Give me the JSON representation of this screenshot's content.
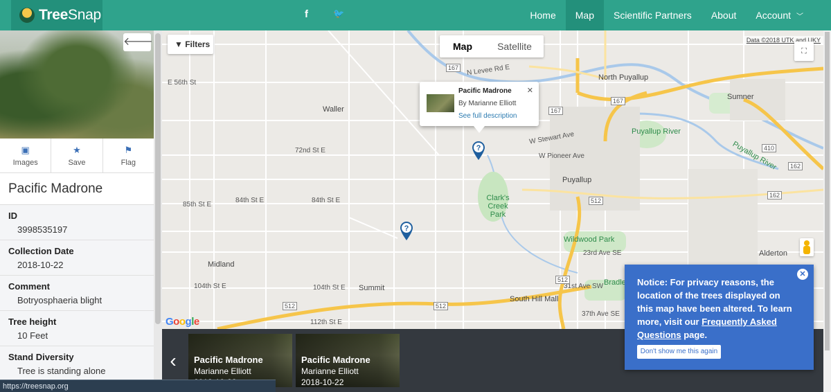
{
  "brand": {
    "name_bold": "Tree",
    "name_rest": "Snap"
  },
  "nav": {
    "social": {
      "facebook": "f",
      "twitter": "🐦"
    },
    "links": [
      "Home",
      "Map",
      "Scientific Partners",
      "About",
      "Account"
    ],
    "active": "Map"
  },
  "sidebar": {
    "back_icon": "arrow-left-icon",
    "actions": [
      {
        "label": "Images",
        "icon": "image-icon"
      },
      {
        "label": "Save",
        "icon": "star-icon"
      },
      {
        "label": "Flag",
        "icon": "flag-icon"
      }
    ],
    "title": "Pacific Madrone",
    "fields": [
      {
        "label": "ID",
        "value": "3998535197"
      },
      {
        "label": "Collection Date",
        "value": "2018-10-22"
      },
      {
        "label": "Comment",
        "value": "Botryosphaeria blight"
      },
      {
        "label": "Tree height",
        "value": "10 Feet"
      },
      {
        "label": "Stand Diversity",
        "value": "Tree is standing alone"
      }
    ]
  },
  "map": {
    "filters_label": "Filters",
    "type_options": [
      "Map",
      "Satellite"
    ],
    "selected_type": "Map",
    "attribution": "Data ©2018 UTK and UKY",
    "google": "Google",
    "labels": {
      "waller": "Waller",
      "north_puyallup": "North Puyallup",
      "sumner": "Sumner",
      "puyallup": "Puyallup",
      "puyallup_river_1": "Puyallup River",
      "puyallup_river_2": "Puyallup River",
      "clarks_creek_park": "Clark's Creek Park",
      "wildwood_park": "Wildwood Park",
      "midland": "Midland",
      "summit": "Summit",
      "alderton": "Alderton",
      "south_hill_mall": "South Hill Mall",
      "bradley": "Bradley",
      "st_72": "72nd St E",
      "st_84": "84th St E",
      "st_84b": "84th St E",
      "st_85": "85th St E",
      "st_104": "104th St E",
      "st_104b": "104th St E",
      "st_112": "112th St E",
      "st_31st": "31st Ave SW",
      "st_23rd": "23rd Ave SE",
      "st_37th": "37th Ave SE",
      "w_pioneer": "W Pioneer Ave",
      "w_stewart": "W Stewart Ave",
      "n_levee": "N Levee Rd E",
      "e_56th": "E 56th St",
      "shields": [
        "167",
        "167",
        "167",
        "410",
        "512",
        "512",
        "512",
        "512",
        "162",
        "162"
      ]
    },
    "popup": {
      "title": "Pacific Madrone",
      "author": "By Marianne Elliott",
      "link": "See full description"
    }
  },
  "carousel": {
    "cards": [
      {
        "name": "Pacific Madrone",
        "author": "Marianne Elliott",
        "date": "2018-10-22"
      },
      {
        "name": "Pacific Madrone",
        "author": "Marianne Elliott",
        "date": "2018-10-22"
      }
    ]
  },
  "notice": {
    "text_before": "Notice: For privacy reasons, the location of the trees displayed on this map have been altered. To learn more, visit our ",
    "link": "Frequently Asked Questions",
    "text_after": " page.",
    "button": "Don't show me this again"
  },
  "status_url": "https://treesnap.org",
  "colors": {
    "nav": "#2fa38c",
    "nav_active": "#23907b",
    "notice": "#3a6fc9",
    "pin": "#1f5f9e",
    "highway": "#f6c54a"
  }
}
